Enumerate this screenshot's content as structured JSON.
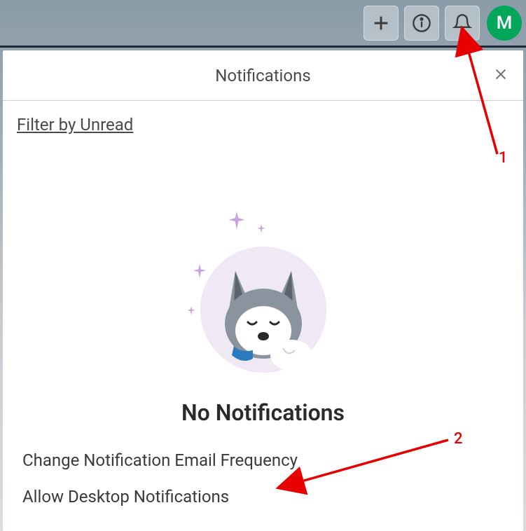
{
  "toolbar": {
    "avatar_initial": "M"
  },
  "panel": {
    "title": "Notifications",
    "filter_label": "Filter by Unread",
    "empty_title": "No Notifications"
  },
  "settings": {
    "email_freq": "Change Notification Email Frequency",
    "desktop": "Allow Desktop Notifications"
  },
  "annotations": {
    "one": "1",
    "two": "2"
  }
}
